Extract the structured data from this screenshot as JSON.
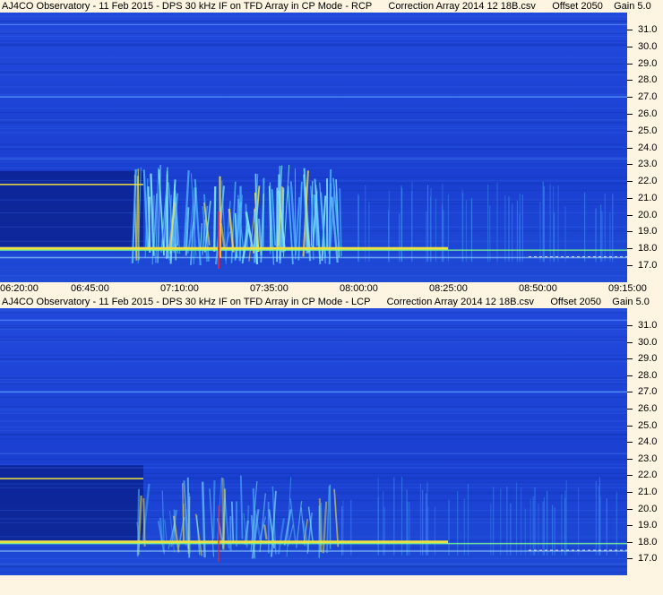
{
  "panels": [
    {
      "title": "AJ4CO Observatory - 11 Feb 2015 - DPS 30 kHz IF on TFD Array in CP Mode - RCP      Correction Array 2014 12 18B.csv      Offset 2050    Gain 5.0",
      "polarization": "RCP"
    },
    {
      "title": "AJ4CO Observatory - 11 Feb 2015 - DPS 30 kHz IF on TFD Array in CP Mode - LCP      Correction Array 2014 12 18B.csv      Offset 2050    Gain 5.0",
      "polarization": "LCP"
    }
  ],
  "chart_data": {
    "type": "heatmap",
    "x_ticks": [
      "06:20:00",
      "06:45:00",
      "07:10:00",
      "07:35:00",
      "08:00:00",
      "08:25:00",
      "08:50:00",
      "09:15:00"
    ],
    "y_ticks": [
      "31.0",
      "30.0",
      "29.0",
      "28.0",
      "27.0",
      "26.0",
      "25.0",
      "24.0",
      "23.0",
      "22.0",
      "21.0",
      "20.0",
      "19.0",
      "18.0",
      "17.0"
    ],
    "ylim": [
      16.5,
      31.7
    ],
    "colors": {
      "background": "#1a3fd1",
      "dark": "#0a1e86",
      "bright": "#7fe8ff",
      "hot": "#f0e040",
      "red": "#ff2020"
    }
  }
}
